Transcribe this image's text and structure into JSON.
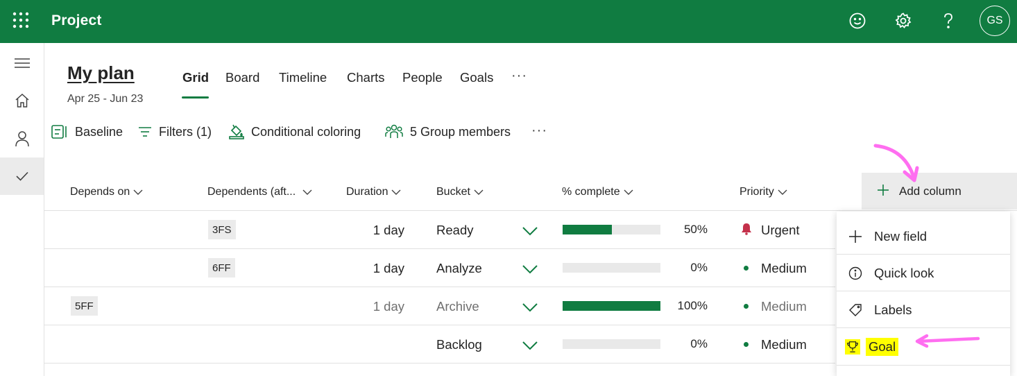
{
  "app": {
    "title": "Project",
    "avatar_initials": "GS",
    "brand_color": "#107c41"
  },
  "plan": {
    "title": "My plan",
    "dates": "Apr 25 - Jun 23"
  },
  "tabs": [
    {
      "label": "Grid",
      "active": true
    },
    {
      "label": "Board"
    },
    {
      "label": "Timeline"
    },
    {
      "label": "Charts"
    },
    {
      "label": "People"
    },
    {
      "label": "Goals"
    }
  ],
  "more_label": "···",
  "commands": {
    "baseline": "Baseline",
    "filters": "Filters (1)",
    "conditional": "Conditional coloring",
    "members": "5 Group members"
  },
  "columns": {
    "depends_on": "Depends on",
    "dependents": "Dependents (aft...",
    "duration": "Duration",
    "bucket": "Bucket",
    "complete": "% complete",
    "priority": "Priority",
    "add_column": "Add column"
  },
  "rows": [
    {
      "depends_on": "",
      "dependents": "3FS",
      "duration": "1 day",
      "bucket": "Ready",
      "progress": 0.5,
      "percent": "50%",
      "priority": "Urgent",
      "priority_icon": "bell-icon",
      "muted": false
    },
    {
      "depends_on": "",
      "dependents": "6FF",
      "duration": "1 day",
      "bucket": "Analyze",
      "progress": 0.0,
      "percent": "0%",
      "priority": "Medium",
      "priority_icon": "dot-icon",
      "muted": false
    },
    {
      "depends_on": "5FF",
      "dependents": "",
      "duration": "1 day",
      "bucket": "Archive",
      "progress": 1.0,
      "percent": "100%",
      "priority": "Medium",
      "priority_icon": "dot-icon",
      "muted": true
    },
    {
      "depends_on": "",
      "dependents": "",
      "duration": "",
      "bucket": "Backlog",
      "progress": 0.0,
      "percent": "0%",
      "priority": "Medium",
      "priority_icon": "dot-icon",
      "muted": false
    }
  ],
  "menu": {
    "items": [
      {
        "label": "New field",
        "icon": "plus-icon"
      },
      {
        "label": "Quick look",
        "icon": "info-icon"
      },
      {
        "label": "Labels",
        "icon": "tag-icon"
      },
      {
        "label": "Goal",
        "icon": "trophy-icon",
        "highlighted": true
      }
    ]
  },
  "colors": {
    "urgent": "#c4314b",
    "highlight": "#ffff00",
    "annotation": "#ff6ef0"
  }
}
